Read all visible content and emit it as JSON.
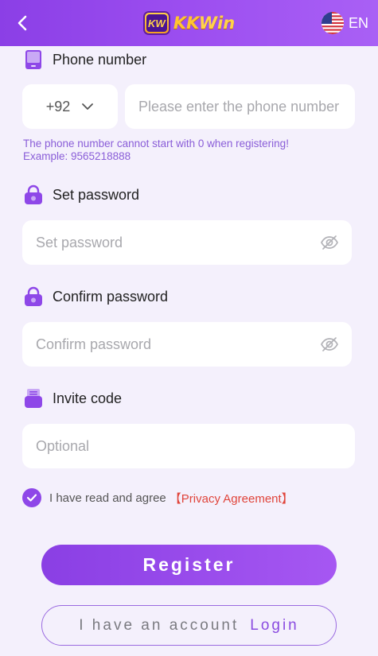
{
  "header": {
    "logo_badge": "KW",
    "logo_kk": "KK",
    "logo_win": "Win",
    "language": "EN"
  },
  "phone": {
    "label": "Phone number",
    "country_code": "+92",
    "placeholder": "Please enter the phone number",
    "hint_line1": "The phone number cannot start with 0 when registering!",
    "hint_line2": "Example: 9565218888"
  },
  "password": {
    "label": "Set password",
    "placeholder": "Set password"
  },
  "confirm": {
    "label": "Confirm password",
    "placeholder": "Confirm password"
  },
  "invite": {
    "label": "Invite code",
    "placeholder": "Optional"
  },
  "agreement": {
    "text": "I have read and agree",
    "link": "【Privacy Agreement】",
    "checked": true
  },
  "actions": {
    "register_label": "Register",
    "have_account": "I have an account",
    "login": "Login"
  },
  "colors": {
    "accent": "#8e47e8",
    "background": "#f4f0fc",
    "link": "#e0443a"
  }
}
